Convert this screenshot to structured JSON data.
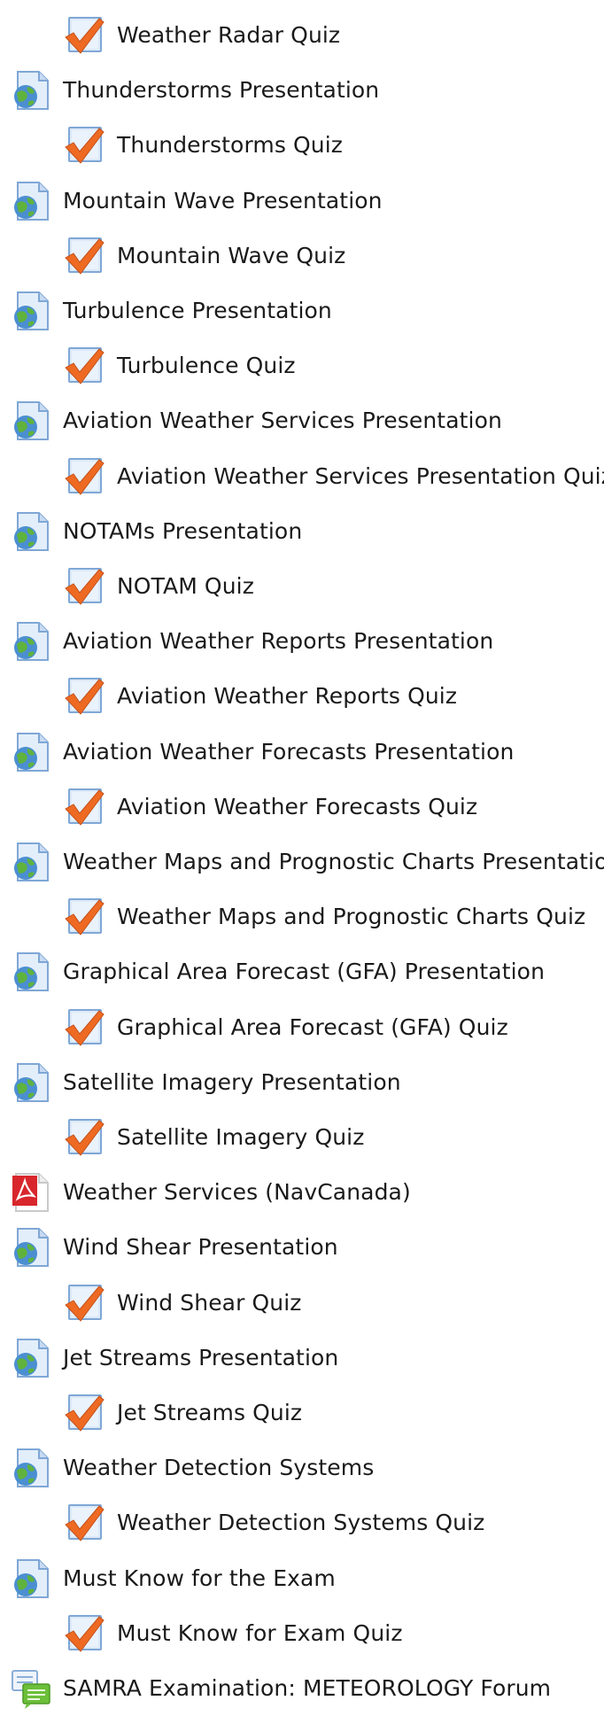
{
  "items": [
    {
      "type": "quiz",
      "label": "Weather Radar Quiz",
      "icon": "quiz-check-icon"
    },
    {
      "type": "page",
      "label": "Thunderstorms Presentation",
      "icon": "web-page-icon"
    },
    {
      "type": "quiz",
      "label": "Thunderstorms Quiz",
      "icon": "quiz-check-icon"
    },
    {
      "type": "page",
      "label": "Mountain Wave Presentation",
      "icon": "web-page-icon"
    },
    {
      "type": "quiz",
      "label": "Mountain Wave Quiz",
      "icon": "quiz-check-icon"
    },
    {
      "type": "page",
      "label": "Turbulence Presentation",
      "icon": "web-page-icon"
    },
    {
      "type": "quiz",
      "label": "Turbulence Quiz",
      "icon": "quiz-check-icon"
    },
    {
      "type": "page",
      "label": "Aviation Weather Services Presentation",
      "icon": "web-page-icon"
    },
    {
      "type": "quiz",
      "label": "Aviation Weather Services Presentation Quiz",
      "icon": "quiz-check-icon"
    },
    {
      "type": "page",
      "label": "NOTAMs Presentation",
      "icon": "web-page-icon"
    },
    {
      "type": "quiz",
      "label": "NOTAM Quiz",
      "icon": "quiz-check-icon"
    },
    {
      "type": "page",
      "label": "Aviation Weather Reports Presentation",
      "icon": "web-page-icon"
    },
    {
      "type": "quiz",
      "label": "Aviation Weather Reports Quiz",
      "icon": "quiz-check-icon"
    },
    {
      "type": "page",
      "label": "Aviation Weather Forecasts Presentation",
      "icon": "web-page-icon"
    },
    {
      "type": "quiz",
      "label": "Aviation Weather Forecasts Quiz",
      "icon": "quiz-check-icon"
    },
    {
      "type": "page",
      "label": "Weather Maps and Prognostic Charts Presentation",
      "icon": "web-page-icon"
    },
    {
      "type": "quiz",
      "label": "Weather Maps and Prognostic Charts Quiz",
      "icon": "quiz-check-icon"
    },
    {
      "type": "page",
      "label": "Graphical Area Forecast (GFA) Presentation",
      "icon": "web-page-icon"
    },
    {
      "type": "quiz",
      "label": "Graphical Area Forecast (GFA) Quiz",
      "icon": "quiz-check-icon"
    },
    {
      "type": "page",
      "label": "Satellite Imagery Presentation",
      "icon": "web-page-icon"
    },
    {
      "type": "quiz",
      "label": "Satellite Imagery Quiz",
      "icon": "quiz-check-icon"
    },
    {
      "type": "pdf",
      "label": "Weather Services (NavCanada)",
      "icon": "pdf-file-icon"
    },
    {
      "type": "page",
      "label": "Wind Shear Presentation",
      "icon": "web-page-icon"
    },
    {
      "type": "quiz",
      "label": "Wind Shear Quiz",
      "icon": "quiz-check-icon"
    },
    {
      "type": "page",
      "label": "Jet Streams Presentation",
      "icon": "web-page-icon"
    },
    {
      "type": "quiz",
      "label": "Jet Streams Quiz",
      "icon": "quiz-check-icon"
    },
    {
      "type": "page",
      "label": "Weather Detection Systems",
      "icon": "web-page-icon"
    },
    {
      "type": "quiz",
      "label": "Weather Detection Systems Quiz",
      "icon": "quiz-check-icon"
    },
    {
      "type": "page",
      "label": "Must Know for the Exam",
      "icon": "web-page-icon"
    },
    {
      "type": "quiz",
      "label": "Must Know for Exam Quiz",
      "icon": "quiz-check-icon"
    },
    {
      "type": "forum",
      "label": "SAMRA Examination: METEOROLOGY Forum",
      "icon": "forum-icon"
    }
  ]
}
